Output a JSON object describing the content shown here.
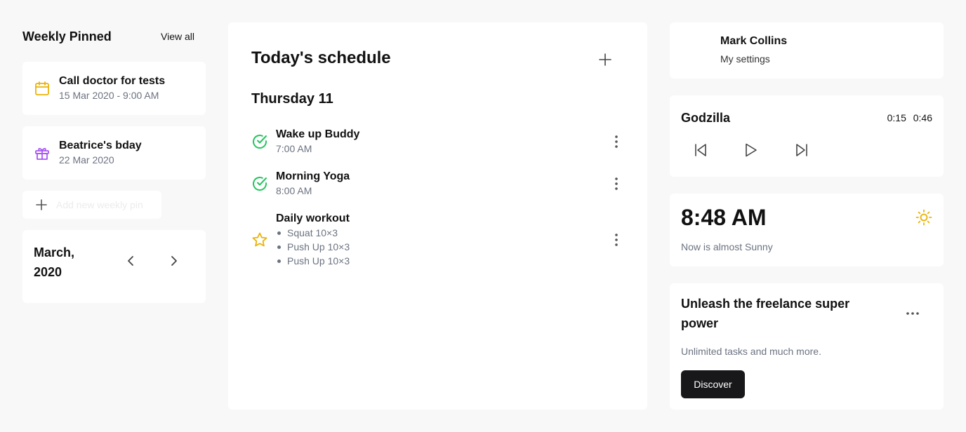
{
  "pinned": {
    "title": "Weekly Pinned",
    "view_all": "View all",
    "items": [
      {
        "title": "Call doctor for tests",
        "sub": "15 Mar 2020 - 9:00 AM",
        "icon": "calendar-icon",
        "color": "#eab308"
      },
      {
        "title": "Beatrice's bday",
        "sub": "22 Mar 2020",
        "icon": "gift-icon",
        "color": "#a855f7"
      }
    ],
    "add_label": "Add new weekly pin"
  },
  "calendar": {
    "month": "March, 2020"
  },
  "schedule": {
    "title": "Today's schedule",
    "day": "Thursday 11",
    "tasks": [
      {
        "title": "Wake up Buddy",
        "time": "7:00 AM",
        "status": "done"
      },
      {
        "title": "Morning Yoga",
        "time": "8:00 AM",
        "status": "done"
      },
      {
        "title": "Daily workout",
        "status": "starred",
        "items": [
          "Squat 10×3",
          "Push Up 10×3",
          "Push Up 10×3"
        ]
      }
    ]
  },
  "profile": {
    "name": "Mark Collins",
    "settings": "My settings"
  },
  "player": {
    "track": "Godzilla",
    "elapsed": "0:15",
    "duration": "0:46"
  },
  "weather": {
    "time": "8:48 AM",
    "text": "Now is almost Sunny"
  },
  "promo": {
    "title": "Unleash the freelance super power",
    "text": "Unlimited tasks and much more.",
    "button": "Discover"
  },
  "colors": {
    "done": "#22c55e",
    "star": "#eab308",
    "calendar": "#eab308",
    "gift": "#a855f7",
    "sun": "#eab308",
    "button": "#18181b"
  }
}
